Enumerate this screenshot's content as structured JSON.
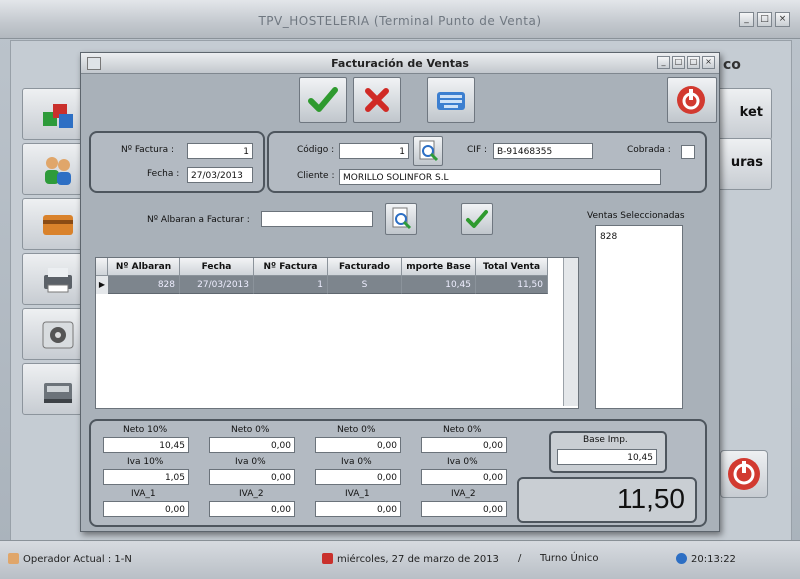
{
  "main_window": {
    "title": "TPV_HOSTELERIA (Terminal Punto de Venta)",
    "right_buttons": [
      "ket",
      "uras"
    ],
    "partial_title_text": "co",
    "win_controls": [
      "_",
      "□",
      "×"
    ]
  },
  "dialog": {
    "title": "Facturación de  Ventas",
    "win_controls": [
      "_",
      "□",
      "□",
      "×"
    ],
    "toolbar": {
      "accept_icon": "green-check-icon",
      "cancel_icon": "red-x-icon",
      "keyboard_icon": "keyboard-icon",
      "exit_icon": "power-icon"
    },
    "factura": {
      "num_label": "Nº Factura :",
      "num_value": "1",
      "fecha_label": "Fecha :",
      "fecha_value": "27/03/2013"
    },
    "cliente": {
      "codigo_label": "Código :",
      "codigo_value": "1",
      "cif_label": "CIF :",
      "cif_value": "B-91468355",
      "cobrada_label": "Cobrada :",
      "cliente_label": "Cliente :",
      "cliente_value": "MORILLO SOLINFOR S.L"
    },
    "albaran": {
      "label": "Nº Albaran a Facturar :",
      "value": ""
    },
    "ventas": {
      "label": "Ventas Seleccionadas",
      "items": [
        "828"
      ]
    },
    "grid": {
      "columns": [
        "Nº Albaran",
        "Fecha",
        "Nº Factura",
        "Facturado",
        "mporte Base",
        "Total Venta"
      ],
      "rows": [
        [
          "828",
          "27/03/2013",
          "1",
          "S",
          "10,45",
          "11,50"
        ]
      ]
    },
    "totals": {
      "neto_10_label": "Neto 10%",
      "neto_10": "10,45",
      "neto_0a_label": "Neto 0%",
      "neto_0a": "0,00",
      "neto_0b_label": "Neto 0%",
      "neto_0b": "0,00",
      "neto_0c_label": "Neto 0%",
      "neto_0c": "0,00",
      "iva_10_label": "Iva 10%",
      "iva_10": "1,05",
      "iva_0a_label": "Iva 0%",
      "iva_0a": "0,00",
      "iva_0b_label": "Iva 0%",
      "iva_0b": "0,00",
      "iva_0c_label": "Iva 0%",
      "iva_0c": "0,00",
      "iva1a_label": "IVA_1",
      "iva1a": "0,00",
      "iva2a_label": "IVA_2",
      "iva2a": "0,00",
      "iva1b_label": "IVA_1",
      "iva1b": "0,00",
      "iva2b_label": "IVA_2",
      "iva2b": "0,00",
      "base_label": "Base Imp.",
      "base_value": "10,45",
      "total": "11,50"
    }
  },
  "status_bar": {
    "operador": "Operador Actual : 1-N",
    "fecha": "miércoles, 27 de marzo de 2013",
    "separator": "/",
    "turno": "Turno Único",
    "hora": "20:13:22"
  }
}
